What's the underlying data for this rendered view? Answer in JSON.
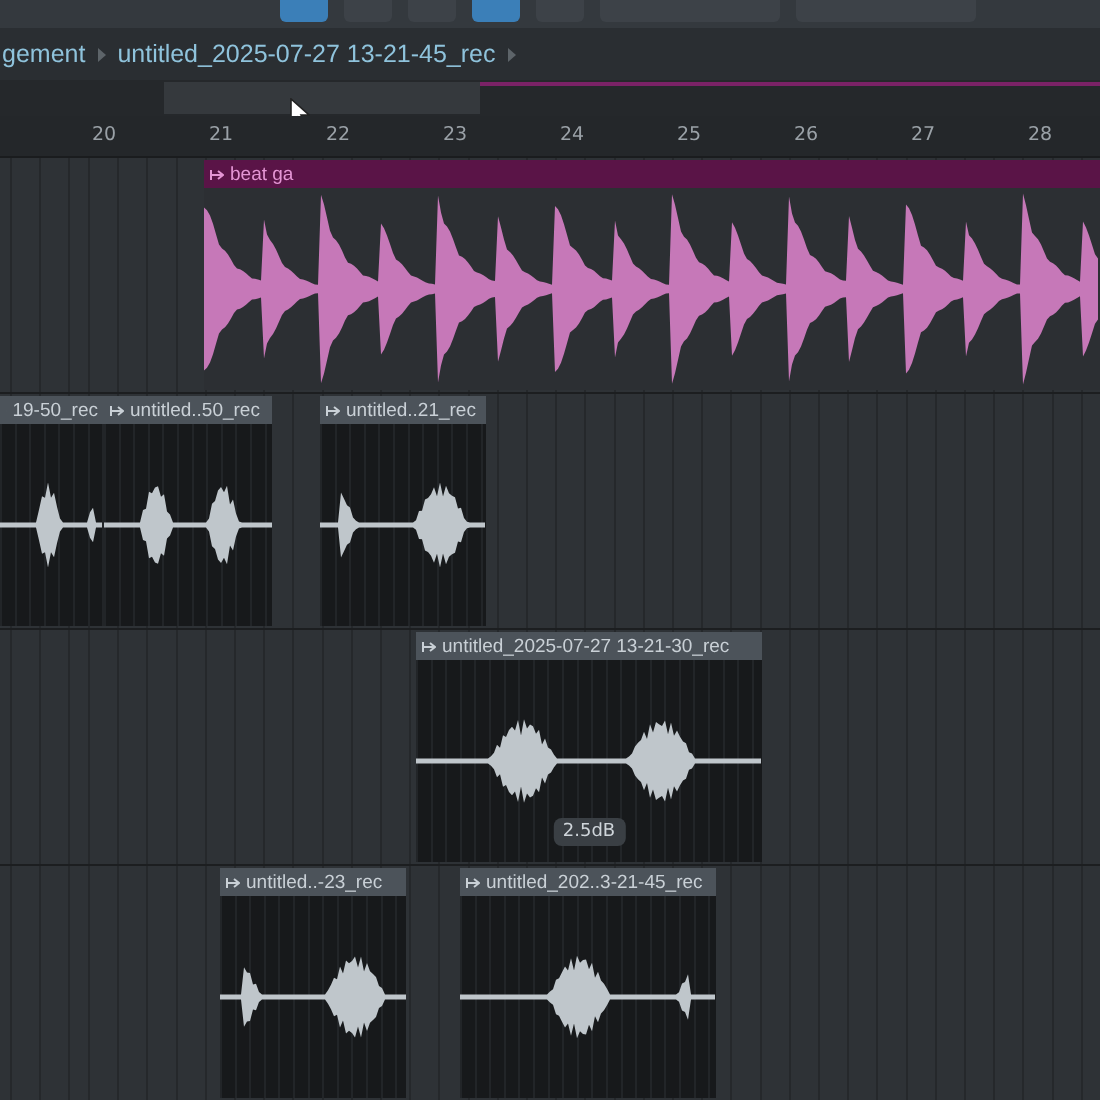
{
  "breadcrumb": [
    "gement",
    "untitled_2025-07-27 13-21-45_rec"
  ],
  "ruler": [
    "20",
    "21",
    "22",
    "23",
    "24",
    "25",
    "26",
    "27",
    "28"
  ],
  "tracks": [
    {
      "clips": [
        {
          "name": "beat ga",
          "kind": "pattern"
        }
      ]
    },
    {
      "clips": [
        {
          "name": "19-50_rec",
          "kind": "audio"
        },
        {
          "name": "untitled..50_rec",
          "kind": "audio"
        },
        {
          "name": "untitled..21_rec",
          "kind": "audio"
        }
      ]
    },
    {
      "clips": [
        {
          "name": "untitled_2025-07-27 13-21-30_rec",
          "kind": "audio",
          "gain": "2.5dB"
        }
      ]
    },
    {
      "clips": [
        {
          "name": "untitled..-23_rec",
          "kind": "audio"
        },
        {
          "name": "untitled_202..3-21-45_rec",
          "kind": "audio"
        }
      ]
    }
  ]
}
